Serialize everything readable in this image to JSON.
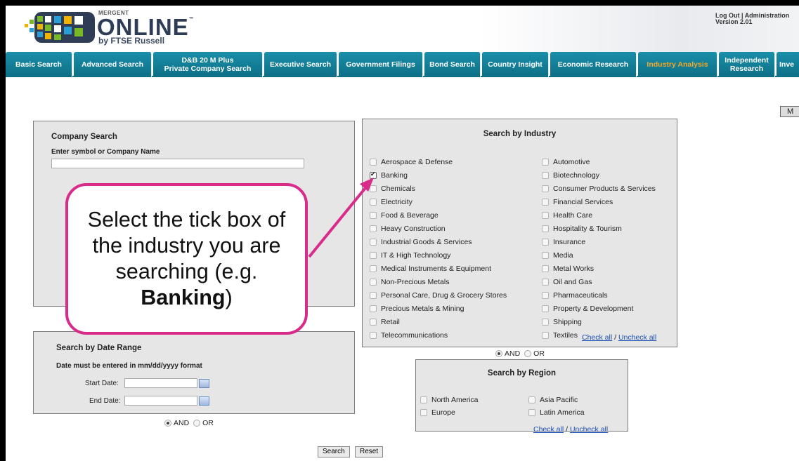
{
  "brand": {
    "mergent": "MERGENT",
    "online": "ONLINE",
    "tm": "™",
    "by": "by FTSE Russell"
  },
  "top_links": {
    "logout": "Log Out",
    "sep": " | ",
    "admin": "Administration",
    "version": "Version 2.01"
  },
  "tabs": [
    {
      "label": "Basic Search"
    },
    {
      "label": "Advanced Search"
    },
    {
      "label": "D&B 20 M Plus\nPrivate Company Search"
    },
    {
      "label": "Executive Search"
    },
    {
      "label": "Government Filings"
    },
    {
      "label": "Bond Search"
    },
    {
      "label": "Country Insight"
    },
    {
      "label": "Economic Research"
    },
    {
      "label": "Industry Analysis",
      "active": true
    },
    {
      "label": "Independent\nResearch"
    },
    {
      "label": "Inve"
    }
  ],
  "side_button": "M",
  "company_search": {
    "title": "Company Search",
    "label": "Enter symbol or Company Name",
    "value": ""
  },
  "industry": {
    "title": "Search by Industry",
    "left": [
      {
        "label": "Aerospace & Defense",
        "checked": false
      },
      {
        "label": "Banking",
        "checked": true
      },
      {
        "label": "Chemicals",
        "checked": false
      },
      {
        "label": "Electricity",
        "checked": false
      },
      {
        "label": "Food & Beverage",
        "checked": false
      },
      {
        "label": "Heavy Construction",
        "checked": false
      },
      {
        "label": "Industrial Goods & Services",
        "checked": false
      },
      {
        "label": "IT & High Technology",
        "checked": false
      },
      {
        "label": "Medical Instruments & Equipment",
        "checked": false
      },
      {
        "label": "Non-Precious Metals",
        "checked": false
      },
      {
        "label": "Personal Care, Drug & Grocery Stores",
        "checked": false
      },
      {
        "label": "Precious Metals & Mining",
        "checked": false
      },
      {
        "label": "Retail",
        "checked": false
      },
      {
        "label": "Telecommunications",
        "checked": false
      }
    ],
    "right": [
      {
        "label": "Automotive",
        "checked": false
      },
      {
        "label": "Biotechnology",
        "checked": false
      },
      {
        "label": "Consumer Products & Services",
        "checked": false
      },
      {
        "label": "Financial Services",
        "checked": false
      },
      {
        "label": "Health Care",
        "checked": false
      },
      {
        "label": "Hospitality & Tourism",
        "checked": false
      },
      {
        "label": "Insurance",
        "checked": false
      },
      {
        "label": "Media",
        "checked": false
      },
      {
        "label": "Metal Works",
        "checked": false
      },
      {
        "label": "Oil and Gas",
        "checked": false
      },
      {
        "label": "Pharmaceuticals",
        "checked": false
      },
      {
        "label": "Property & Development",
        "checked": false
      },
      {
        "label": "Shipping",
        "checked": false
      },
      {
        "label": "Textiles",
        "checked": false
      }
    ],
    "check_all": "Check all",
    "uncheck_all": "Uncheck all",
    "sep": " / "
  },
  "andor_industry": {
    "and": "AND",
    "or": "OR",
    "selected": "AND"
  },
  "region": {
    "title": "Search by Region",
    "items": [
      {
        "label": "North America",
        "checked": false
      },
      {
        "label": "Asia Pacific",
        "checked": false
      },
      {
        "label": "Europe",
        "checked": false
      },
      {
        "label": "Latin America",
        "checked": false
      }
    ],
    "check_all": "Check all",
    "uncheck_all": "Uncheck all",
    "sep": " / "
  },
  "date_range": {
    "title": "Search by Date Range",
    "format_note": "Date must be entered in mm/dd/yyyy format",
    "start_label": "Start Date:",
    "end_label": "End Date:",
    "start_value": "",
    "end_value": ""
  },
  "andor_date": {
    "and": "AND",
    "or": "OR",
    "selected": "AND"
  },
  "buttons": {
    "search": "Search",
    "reset": "Reset"
  },
  "callout": {
    "text_before": "Select the tick box of the industry you are searching (e.g. ",
    "bold": "Banking",
    "text_after": ")"
  },
  "colors": {
    "tab_bg": "#0d6f86",
    "tab_active_text": "#f3a72c",
    "callout_border": "#d92b8a",
    "link": "#1a4fb3"
  }
}
